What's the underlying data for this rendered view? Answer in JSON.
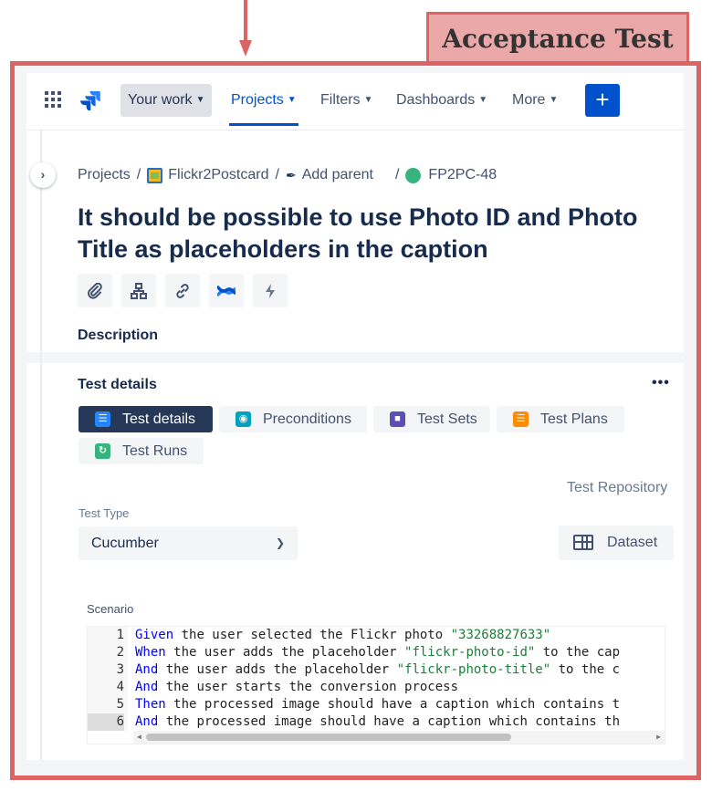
{
  "annotation": {
    "label": "Acceptance Test"
  },
  "nav": {
    "your_work": "Your work",
    "projects": "Projects",
    "filters": "Filters",
    "dashboards": "Dashboards",
    "more": "More",
    "create": "+"
  },
  "breadcrumb": {
    "projects": "Projects",
    "project": "Flickr2Postcard",
    "add_parent": "Add parent",
    "issue_key": "FP2PC-48"
  },
  "issue": {
    "title": "It should be possible to use Photo ID and Photo Title as placeholders in the caption",
    "toolbar_icons": [
      "attachment-icon",
      "child-issues-icon",
      "link-icon",
      "confluence-icon",
      "automation-icon"
    ],
    "description_label": "Description"
  },
  "test_details": {
    "heading": "Test details",
    "more": "•••",
    "tabs": [
      {
        "label": "Test details",
        "icon": "test-details-icon",
        "color": "#2684ff"
      },
      {
        "label": "Preconditions",
        "icon": "preconditions-icon",
        "color": "#00a3bf"
      },
      {
        "label": "Test Sets",
        "icon": "test-sets-icon",
        "color": "#5e4db2"
      },
      {
        "label": "Test Plans",
        "icon": "test-plans-icon",
        "color": "#ff8b00"
      },
      {
        "label": "Test Runs",
        "icon": "test-runs-icon",
        "color": "#36b37e"
      }
    ],
    "repository_link": "Test Repository",
    "test_type_label": "Test Type",
    "test_type_value": "Cucumber",
    "dataset_label": "Dataset",
    "scenario_label": "Scenario",
    "scenario_lines": [
      {
        "n": "1",
        "kw": "Given",
        "rest": " the user selected the Flickr photo ",
        "str": "\"33268827633\"",
        "tail": ""
      },
      {
        "n": "2",
        "kw": "When",
        "rest": " the user adds the placeholder ",
        "str": "\"flickr-photo-id\"",
        "tail": " to the cap"
      },
      {
        "n": "3",
        "kw": "And",
        "rest": " the user adds the placeholder ",
        "str": "\"flickr-photo-title\"",
        "tail": " to the c"
      },
      {
        "n": "4",
        "kw": "And",
        "rest": " the user starts the conversion process",
        "str": "",
        "tail": ""
      },
      {
        "n": "5",
        "kw": "Then",
        "rest": " the processed image should have a caption which contains t",
        "str": "",
        "tail": ""
      },
      {
        "n": "6",
        "kw": "And",
        "rest": " the processed image should have a caption which contains th",
        "str": "",
        "tail": ""
      }
    ]
  },
  "colors": {
    "annotation_border": "#dc6464",
    "annotation_fill": "#eaa8a8",
    "jira_blue": "#0052cc",
    "active_tab": "#253858"
  }
}
